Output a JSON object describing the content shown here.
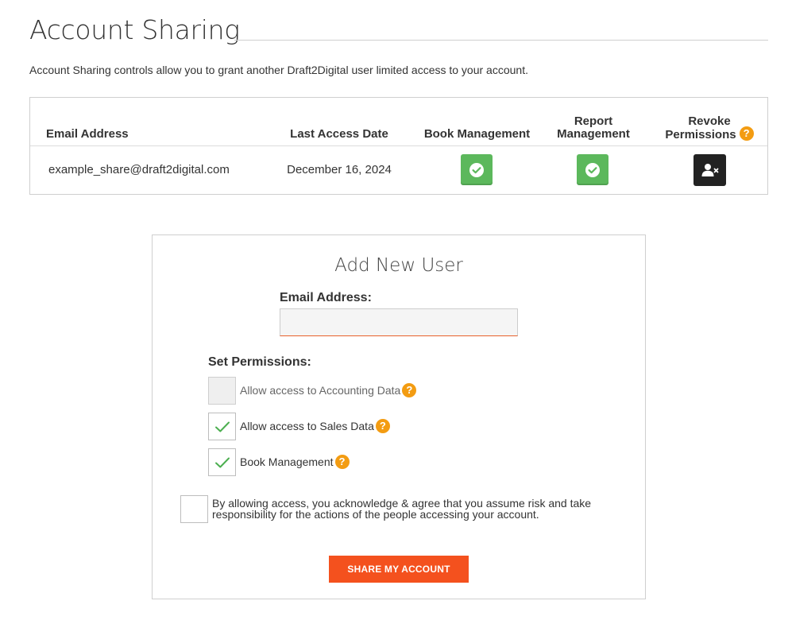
{
  "page": {
    "title": "Account Sharing",
    "intro": "Account Sharing controls allow you to grant another Draft2Digital user limited access to your account."
  },
  "table": {
    "headers": {
      "email": "Email Address",
      "last_access": "Last Access Date",
      "book": "Book Management",
      "report_line1": "Report",
      "report_line2": "Management",
      "revoke_line1": "Revoke",
      "revoke_line2": "Permissions",
      "revoke_help": "?"
    },
    "rows": [
      {
        "email": "example_share@draft2digital.com",
        "last_access": "December 16, 2024",
        "book_management": true,
        "report_management": true
      }
    ]
  },
  "add_user": {
    "title": "Add New User",
    "email_label": "Email Address:",
    "email_value": "",
    "email_placeholder": "",
    "permissions_label": "Set Permissions:",
    "permissions": [
      {
        "label": "Allow access to Accounting Data",
        "checked": false,
        "disabled": true,
        "help": "?"
      },
      {
        "label": "Allow access to Sales Data",
        "checked": true,
        "disabled": false,
        "help": "?"
      },
      {
        "label": "Book Management",
        "checked": true,
        "disabled": false,
        "help": "?"
      }
    ],
    "acknowledge_line1": "By allowing access, you acknowledge & agree that you assume risk and take",
    "acknowledge_line2": "responsibility for the actions of the people accessing your account.",
    "acknowledge_checked": false,
    "share_button": "SHARE MY ACCOUNT"
  },
  "colors": {
    "success_green": "#5cb85c",
    "revoke_black": "#222222",
    "help_orange": "#f39c12",
    "cta_orange": "#f4511e",
    "check_green": "#4caf50"
  },
  "icons": {
    "permission_granted": "check-circle-icon",
    "revoke": "user-remove-icon",
    "help": "question-circle-icon",
    "checkbox_checked": "checkmark-icon"
  }
}
